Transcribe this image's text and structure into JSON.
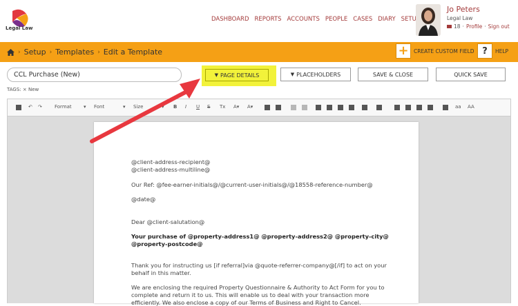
{
  "brand": {
    "name": "Legal Law"
  },
  "nav": [
    "DASHBOARD",
    "REPORTS",
    "ACCOUNTS",
    "PEOPLE",
    "CASES",
    "DIARY",
    "SETUP"
  ],
  "user": {
    "name": "Jo Peters",
    "firm": "Legal Law",
    "mail_count": "18",
    "profile": "Profile",
    "signout": "Sign out"
  },
  "breadcrumb": {
    "items": [
      "Setup",
      "Templates",
      "Edit a Template"
    ]
  },
  "actions": {
    "create_field": "CREATE CUSTOM FIELD",
    "help": "HELP",
    "plus": "+",
    "q": "?"
  },
  "template": {
    "name": "CCL Purchase (New)"
  },
  "buttons": {
    "page_details": "PAGE DETAILS",
    "placeholders": "PLACEHOLDERS",
    "save_close": "SAVE & CLOSE",
    "quick_save": "QUICK SAVE"
  },
  "tags": {
    "label": "TAGS:",
    "value": "New"
  },
  "toolbar": {
    "format": "Format",
    "font": "Font",
    "size": "Size"
  },
  "document": {
    "l1": "@client-address-recipient@",
    "l2": "@client-address-multiline@",
    "l3": "Our Ref:  @fee-earner-initials@/@current-user-initials@/@18558-reference-number@",
    "l4": "@date@",
    "l5": "Dear @client-salutation@",
    "l6": "Your purchase of @property-address1@ @property-address2@ @property-city@",
    "l7": "@property-postcode@",
    "l8": "Thank you for instructing us [if referral]via @quote-referrer-company@[/if] to act on your",
    "l9": "behalf in this matter.",
    "l10": "We are enclosing the required Property Questionnaire & Authority to Act Form for you to",
    "l11": "complete and return it to us. This will enable us to deal with your transaction more",
    "l12": "efficiently. We also enclose a copy of our Terms of Business and Right to Cancel."
  },
  "colors": {
    "accent": "#f5a015",
    "link": "#a33a3a",
    "highlight": "#f2f23a",
    "arrow": "#e8383f"
  }
}
